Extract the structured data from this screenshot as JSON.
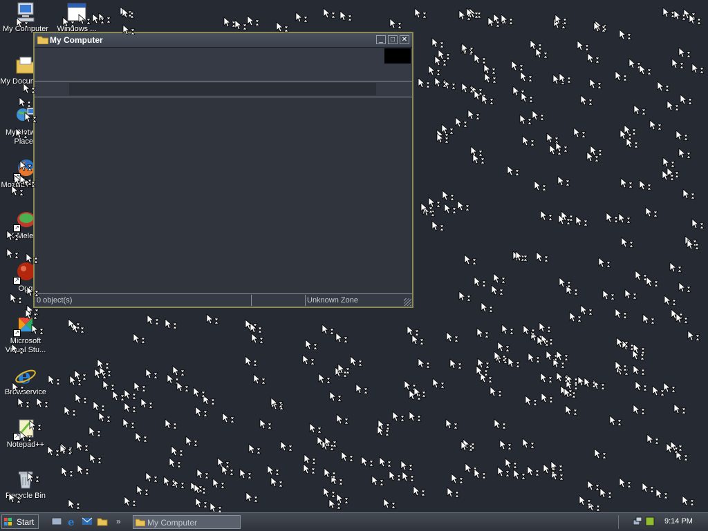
{
  "desktop": {
    "icons": [
      {
        "label": "My Computer"
      },
      {
        "label": "Windows ..."
      },
      {
        "label": "My Documents"
      },
      {
        "label": "My Network Places"
      },
      {
        "label": "Mozilla Firefox"
      },
      {
        "label": "K-Meleon"
      },
      {
        "label": "Ogg"
      },
      {
        "label": "Microsoft Visual Stu..."
      },
      {
        "label": "Browservice"
      },
      {
        "label": "Notepad++"
      },
      {
        "label": "Recycle Bin"
      }
    ]
  },
  "window": {
    "title": "My Computer",
    "buttons": {
      "minimize": "_",
      "maximize": "□",
      "close": "✕"
    },
    "status": {
      "objects": "0 object(s)",
      "zone": "Unknown Zone"
    }
  },
  "taskbar": {
    "start_label": "Start",
    "quick_launch": [
      "desktop-icon",
      "internet-explorer-icon",
      "outlook-icon",
      "folder-icon"
    ],
    "overflow": "»",
    "task_label": "My Computer",
    "clock": "9:14 PM"
  },
  "colors": {
    "desktop_bg": "#262a33",
    "window_border": "#8c8a55",
    "window_bg": "#2f343d"
  }
}
